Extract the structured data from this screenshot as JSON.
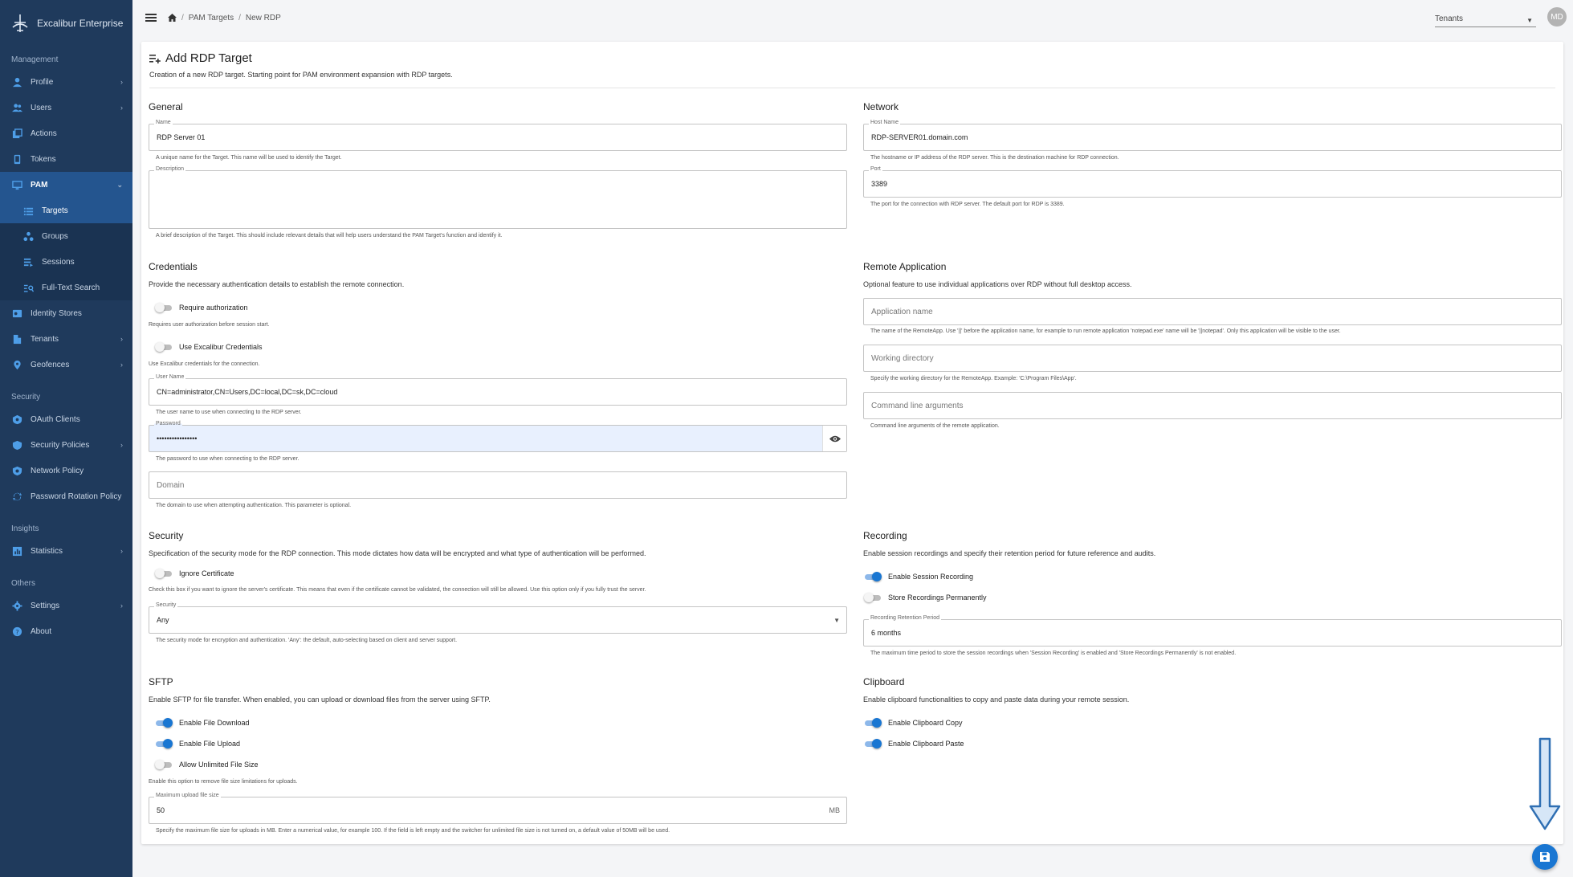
{
  "app": {
    "brand": "Excalibur Enterprise"
  },
  "colors": {
    "sidebar": "#1f3a5c",
    "accent": "#1976d2",
    "sidebar_active": "#24558f"
  },
  "sidebar": {
    "sections": {
      "management": "Management",
      "security": "Security",
      "insights": "Insights",
      "others": "Others"
    },
    "items": {
      "profile": "Profile",
      "users": "Users",
      "actions": "Actions",
      "tokens": "Tokens",
      "pam": "PAM",
      "targets": "Targets",
      "groups": "Groups",
      "sessions": "Sessions",
      "fulltext": "Full-Text Search",
      "identity": "Identity Stores",
      "tenants": "Tenants",
      "geofences": "Geofences",
      "oauth": "OAuth Clients",
      "secpolicies": "Security Policies",
      "netpolicy": "Network Policy",
      "pwrotation": "Password Rotation Policy",
      "statistics": "Statistics",
      "settings": "Settings",
      "about": "About"
    }
  },
  "header": {
    "breadcrumb": [
      "PAM Targets",
      "New RDP"
    ],
    "tenants": "Tenants",
    "avatar": "MD"
  },
  "page": {
    "title": "Add RDP Target",
    "subtitle": "Creation of a new RDP target. Starting point for PAM environment expansion with RDP targets."
  },
  "general": {
    "title": "General",
    "name_label": "Name",
    "name_value": "RDP Server 01",
    "name_hint": "A unique name for the Target. This name will be used to identify the Target.",
    "desc_label": "Description",
    "desc_hint": "A brief description of the Target. This should include relevant details that will help users understand the PAM Target's function and identify it."
  },
  "network": {
    "title": "Network",
    "host_label": "Host Name",
    "host_value": "RDP-SERVER01.domain.com",
    "host_hint": "The hostname or IP address of the RDP server. This is the destination machine for RDP connection.",
    "port_label": "Port",
    "port_value": "3389",
    "port_hint": "The port for the connection with RDP server. The default port for RDP is 3389."
  },
  "credentials": {
    "title": "Credentials",
    "desc": "Provide the necessary authentication details to establish the remote connection.",
    "req_auth_label": "Require authorization",
    "req_auth_hint": "Requires user authorization before session start.",
    "use_excal_label": "Use Excalibur Credentials",
    "use_excal_hint": "Use Excalibur credentials for the connection.",
    "username_label": "User Name",
    "username_value": "CN=administrator,CN=Users,DC=local,DC=sk,DC=cloud",
    "username_hint": "The user name to use when connecting to the RDP server.",
    "password_label": "Password",
    "password_value": "••••••••••••••••",
    "password_hint": "The password to use when connecting to the RDP server.",
    "domain_placeholder": "Domain",
    "domain_hint": "The domain to use when attempting authentication. This parameter is optional."
  },
  "remote_app": {
    "title": "Remote Application",
    "desc": "Optional feature to use individual applications over RDP without full desktop access.",
    "app_name_placeholder": "Application name",
    "app_name_hint": "The name of the RemoteApp. Use '||' before the application name, for example to run remote application 'notepad.exe' name will be '||notepad'. Only this application will be visible to the user.",
    "workdir_placeholder": "Working directory",
    "workdir_hint": "Specify the working directory for the RemoteApp. Example: 'C:\\Program Files\\App'.",
    "cmd_placeholder": "Command line arguments",
    "cmd_hint": "Command line arguments of the remote application."
  },
  "security": {
    "title": "Security",
    "desc": "Specification of the security mode for the RDP connection. This mode dictates how data will be encrypted and what type of authentication will be performed.",
    "ignore_cert_label": "Ignore Certificate",
    "ignore_cert_hint": "Check this box if you want to ignore the server's certificate. This means that even if the certificate cannot be validated, the connection will still be allowed. Use this option only if you fully trust the server.",
    "mode_label": "Security",
    "mode_value": "Any",
    "mode_hint": "The security mode for encryption and authentication. 'Any': the default, auto-selecting based on client and server support."
  },
  "recording": {
    "title": "Recording",
    "desc": "Enable session recordings and specify their retention period for future reference and audits.",
    "enable_label": "Enable Session Recording",
    "store_label": "Store Recordings Permanently",
    "retention_label": "Recording Retention Period",
    "retention_value": "6 months",
    "retention_hint": "The maximum time period to store the session recordings when 'Session Recording' is enabled and 'Store Recordings Permanently' is not enabled."
  },
  "sftp": {
    "title": "SFTP",
    "desc": "Enable SFTP for file transfer. When enabled, you can upload or download files from the server using SFTP.",
    "download_label": "Enable File Download",
    "upload_label": "Enable File Upload",
    "unlimited_label": "Allow Unlimited File Size",
    "unlimited_hint": "Enable this option to remove file size limitations for uploads.",
    "max_label": "Maximum upload file size",
    "max_value": "50",
    "max_unit": "MB",
    "max_hint": "Specify the maximum file size for uploads in MB. Enter a numerical value, for example 100. If the field is left empty and the switcher for unlimited file size is not turned on, a default value of 50MB will be used."
  },
  "clipboard": {
    "title": "Clipboard",
    "desc": "Enable clipboard functionalities to copy and paste data during your remote session.",
    "copy_label": "Enable Clipboard Copy",
    "paste_label": "Enable Clipboard Paste"
  }
}
